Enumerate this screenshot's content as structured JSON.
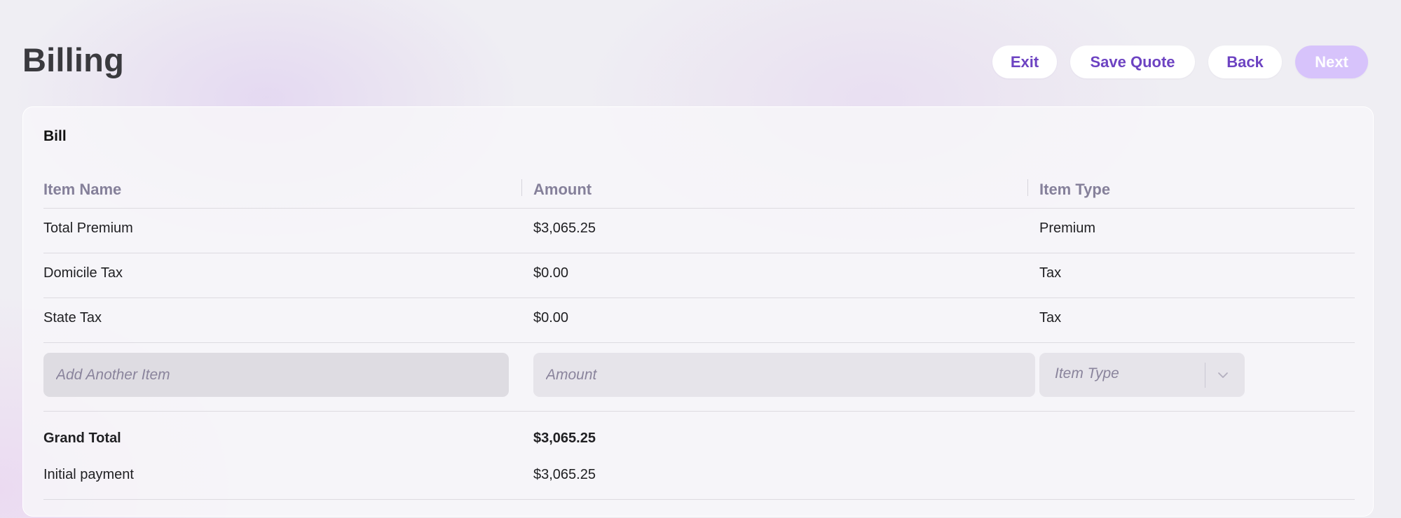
{
  "page": {
    "title": "Billing"
  },
  "toolbar": {
    "exit_label": "Exit",
    "save_quote_label": "Save Quote",
    "back_label": "Back",
    "next_label": "Next"
  },
  "bill": {
    "title": "Bill",
    "columns": [
      "Item Name",
      "Amount",
      "Item Type"
    ],
    "rows": [
      {
        "name": "Total Premium",
        "amount": "$3,065.25",
        "type": "Premium"
      },
      {
        "name": "Domicile Tax",
        "amount": "$0.00",
        "type": "Tax"
      },
      {
        "name": "State Tax",
        "amount": "$0.00",
        "type": "Tax"
      }
    ],
    "new_item": {
      "name_placeholder": "Add Another Item",
      "amount_placeholder": "Amount",
      "type_placeholder": "Item Type",
      "type_icon": "chevron-down-icon"
    },
    "grand_total": {
      "label": "Grand Total",
      "value": "$3,065.25"
    },
    "initial_payment": {
      "label": "Initial payment",
      "value": "$3,065.25"
    }
  },
  "colors": {
    "accent": "#6d43c2",
    "next_disabled_bg": "#d7c3fb",
    "header_text": "#85809a"
  }
}
